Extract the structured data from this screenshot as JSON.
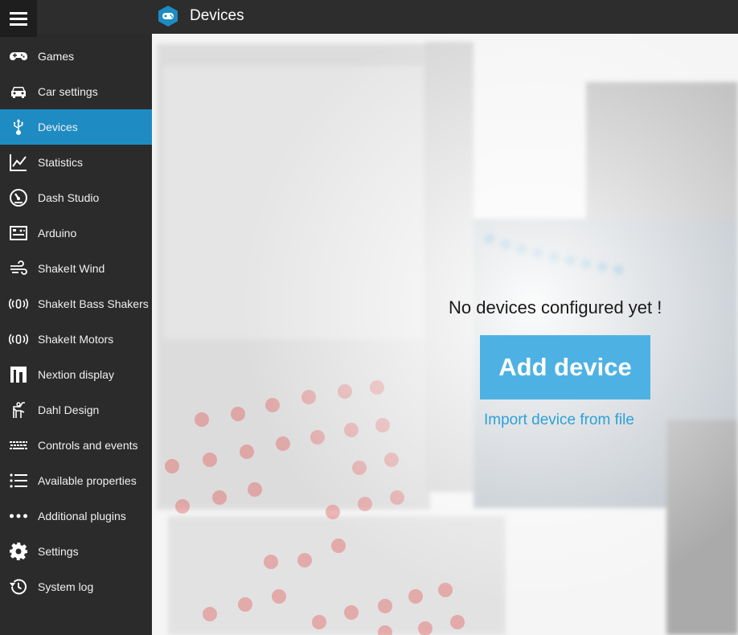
{
  "header": {
    "title": "Devices"
  },
  "sidebar": {
    "items": [
      {
        "label": "Games",
        "icon": "gamepad-icon"
      },
      {
        "label": "Car settings",
        "icon": "car-icon"
      },
      {
        "label": "Devices",
        "icon": "usb-icon",
        "active": true
      },
      {
        "label": "Statistics",
        "icon": "line-chart-icon"
      },
      {
        "label": "Dash Studio",
        "icon": "gauge-icon"
      },
      {
        "label": "Arduino",
        "icon": "circuit-board-icon"
      },
      {
        "label": "ShakeIt Wind",
        "icon": "wind-icon"
      },
      {
        "label": "ShakeIt Bass Shakers",
        "icon": "vibration-icon"
      },
      {
        "label": "ShakeIt Motors",
        "icon": "vibration-icon"
      },
      {
        "label": "Nextion display",
        "icon": "nextion-icon"
      },
      {
        "label": "Dahl Design",
        "icon": "dahl-design-icon"
      },
      {
        "label": "Controls and events",
        "icon": "keyboard-icon"
      },
      {
        "label": "Available properties",
        "icon": "list-icon"
      },
      {
        "label": "Additional plugins",
        "icon": "ellipsis-icon"
      },
      {
        "label": "Settings",
        "icon": "gear-icon"
      },
      {
        "label": "System log",
        "icon": "history-icon"
      }
    ]
  },
  "main": {
    "empty_message": "No devices configured yet !",
    "add_button_label": "Add device",
    "import_link_label": "Import device from file"
  },
  "colors": {
    "accent": "#1e8bc3",
    "button": "#4db2e3",
    "link": "#2ea0d8",
    "sidebar_bg": "#2b2b2b"
  }
}
